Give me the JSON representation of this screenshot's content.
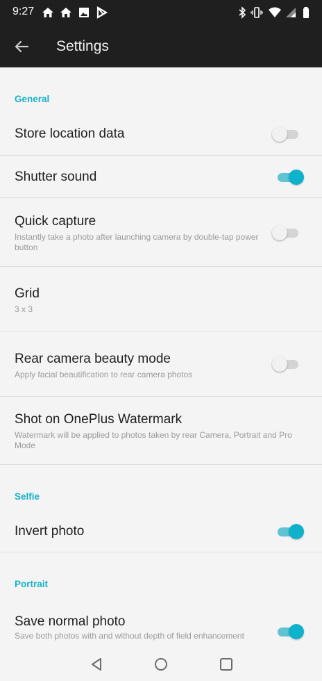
{
  "status_bar": {
    "time": "9:27",
    "left_icons": [
      "home-icon",
      "home-icon",
      "image-icon",
      "play-store-icon"
    ],
    "right_icons": [
      "bluetooth-icon",
      "vibrate-icon",
      "wifi-icon",
      "signal-icon",
      "battery-icon"
    ]
  },
  "app_bar": {
    "title": "Settings",
    "back_icon": "arrow-back-icon"
  },
  "sections": {
    "general": "General",
    "selfie": "Selfie",
    "portrait": "Portrait"
  },
  "settings": {
    "store_location": {
      "label": "Store location data",
      "on": false
    },
    "shutter_sound": {
      "label": "Shutter sound",
      "on": true
    },
    "quick_capture": {
      "label": "Quick capture",
      "sub": "Instantly take a photo after launching camera by double-tap power button",
      "on": false
    },
    "grid": {
      "label": "Grid",
      "sub": "3 x 3"
    },
    "rear_beauty": {
      "label": "Rear camera beauty mode",
      "sub": "Apply facial beautification to rear camera photos",
      "on": false
    },
    "watermark": {
      "label": "Shot on OnePlus Watermark",
      "sub": "Watermark will be applied to photos taken by rear Camera, Portrait and Pro Mode"
    },
    "invert_photo": {
      "label": "Invert photo",
      "on": true
    },
    "save_normal": {
      "label": "Save normal photo",
      "sub": "Save both photos with and without depth of field enhancement",
      "on": true
    }
  },
  "nav_bar": {
    "icons": [
      "back-triangle-icon",
      "home-circle-icon",
      "recents-square-icon"
    ]
  },
  "colors": {
    "accent": "#19b1c7",
    "toggle_on_thumb": "#0fb2cc",
    "toggle_on_track": "#5fc3d3",
    "bar_background": "#1f1f1f",
    "page_background": "#f4f4f4"
  }
}
